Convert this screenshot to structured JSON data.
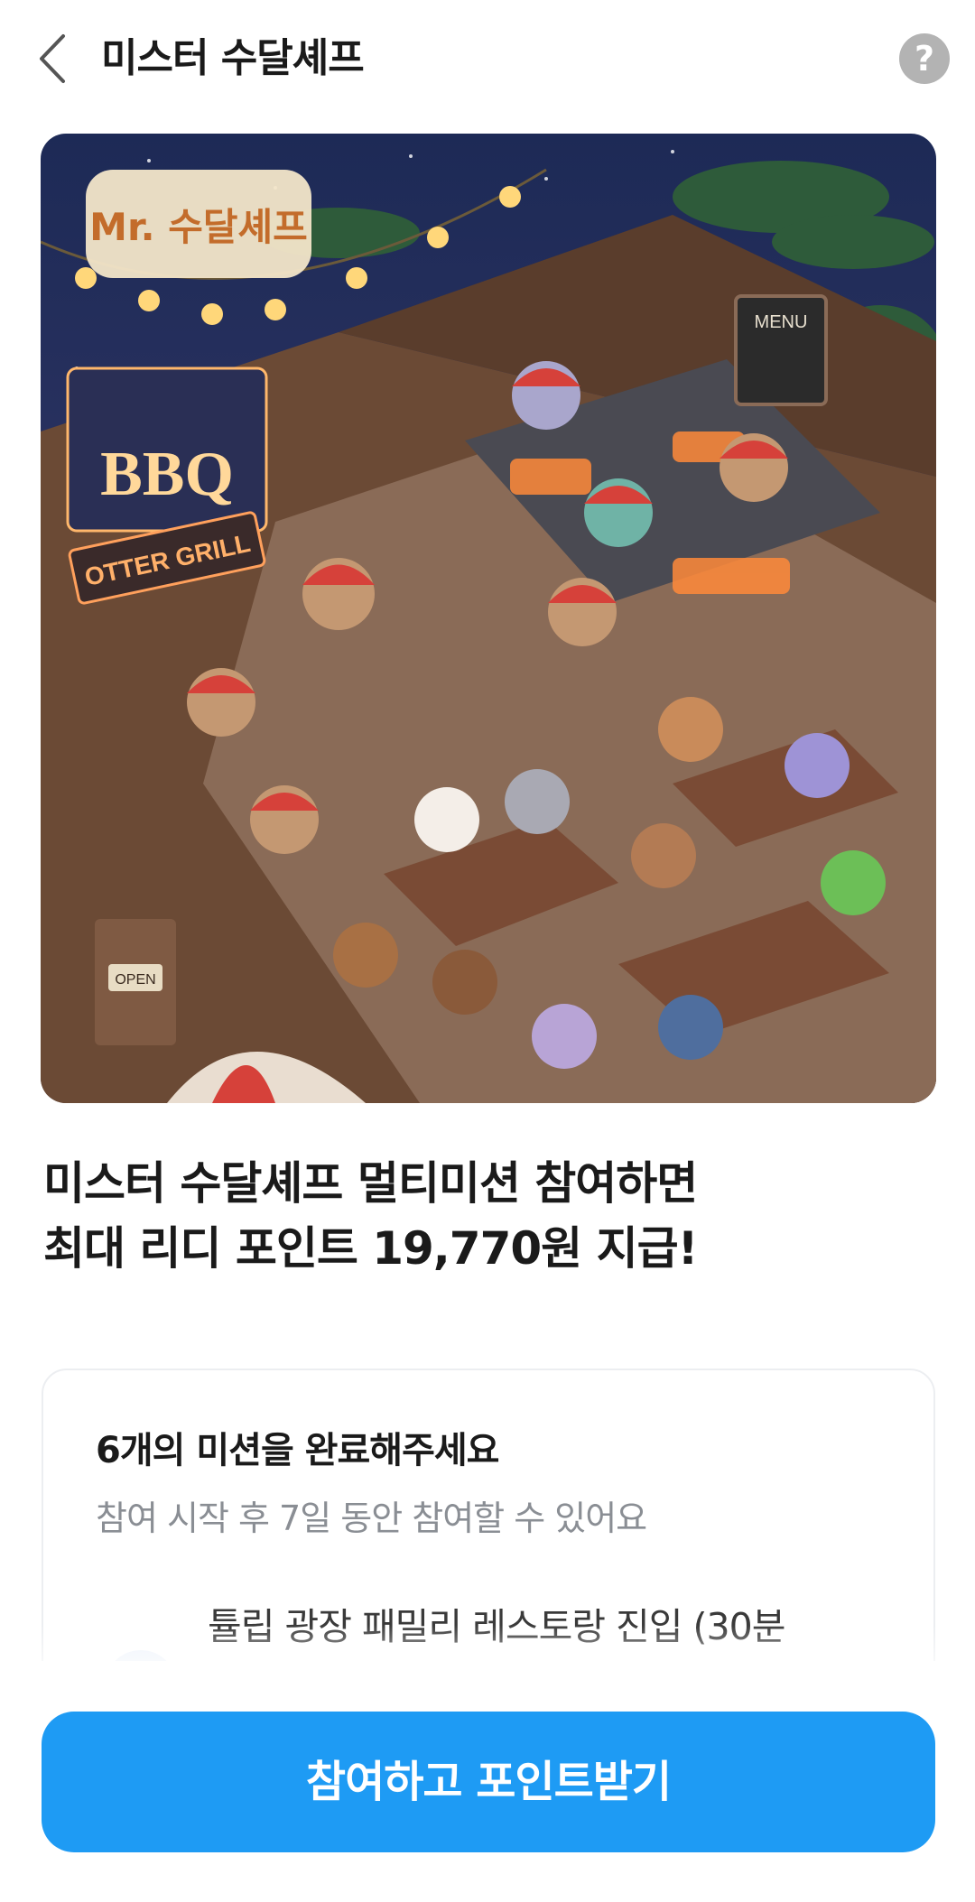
{
  "header": {
    "title": "미스터 수달셰프",
    "back_icon": "chevron-left-icon",
    "help_label": "?"
  },
  "banner": {
    "logo_text": "Mr. 수달셰프",
    "sign_bbq": "BBQ",
    "sign_otter_grill": "OTTER GRILL",
    "menu_board": "MENU",
    "open_sign": "OPEN"
  },
  "headline": {
    "line1": "미스터 수달셰프 멀티미션 참여하면",
    "line2": "최대 리디 포인트 19,770원 지급!"
  },
  "mission_card": {
    "title": "6개의 미션을 완료해주세요",
    "subtitle": "참여 시작 후 7일 동안 참여할 수 있어요",
    "missions": [
      {
        "label": "튤립 광장 패밀리 레스토랑 진입 (30분"
      }
    ]
  },
  "cta": {
    "label": "참여하고 포인트받기"
  },
  "colors": {
    "accent": "#1e9bf4",
    "help_bg": "#b3b3b3",
    "subtext": "#8a8e94"
  }
}
